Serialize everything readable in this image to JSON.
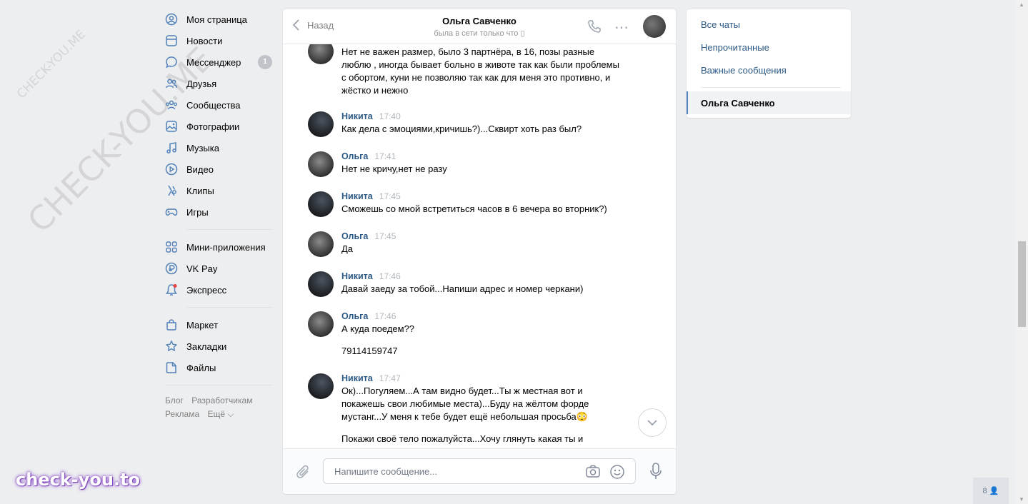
{
  "nav": {
    "items": [
      {
        "label": "Моя страница",
        "icon": "user-circle-icon"
      },
      {
        "label": "Новости",
        "icon": "news-icon"
      },
      {
        "label": "Мессенджер",
        "icon": "message-icon",
        "badge": "1"
      },
      {
        "label": "Друзья",
        "icon": "friends-icon"
      },
      {
        "label": "Сообщества",
        "icon": "communities-icon"
      },
      {
        "label": "Фотографии",
        "icon": "photo-icon"
      },
      {
        "label": "Музыка",
        "icon": "music-icon"
      },
      {
        "label": "Видео",
        "icon": "video-icon"
      },
      {
        "label": "Клипы",
        "icon": "clips-icon"
      },
      {
        "label": "Игры",
        "icon": "gamepad-icon"
      }
    ],
    "items2": [
      {
        "label": "Мини-приложения",
        "icon": "apps-icon"
      },
      {
        "label": "VK Pay",
        "icon": "vkpay-icon"
      },
      {
        "label": "Экспресс",
        "icon": "express-icon"
      }
    ],
    "items3": [
      {
        "label": "Маркет",
        "icon": "market-icon"
      },
      {
        "label": "Закладки",
        "icon": "bookmark-star-icon"
      },
      {
        "label": "Файлы",
        "icon": "file-icon"
      }
    ],
    "footer": [
      "Блог",
      "Разработчикам",
      "Реклама",
      "Ещё ⌵"
    ]
  },
  "chat": {
    "back_label": "Назад",
    "peer_name": "Ольга Савченко",
    "peer_status": "была в сети только что",
    "composer_placeholder": "Напишите сообщение...",
    "messages": [
      {
        "author": "",
        "time": "",
        "text": "Нет не важен размер, было 3 партнёра, в 16, позы разные люблю , иногда бывает больно в животе так как были проблемы с обортом, куни не позволяю так как для меня это противно, и жёстко и нежно"
      },
      {
        "author": "Никита",
        "time": "17:40",
        "text": "Как дела с эмоциями,кричишь?)...Сквирт хоть раз был?"
      },
      {
        "author": "Ольга",
        "time": "17:41",
        "text": "Нет не кричу,нет не разу"
      },
      {
        "author": "Никита",
        "time": "17:45",
        "text": "Сможешь со мной встретиться часов в 6 вечера во вторник?)"
      },
      {
        "author": "Ольга",
        "time": "17:45",
        "text": "Да"
      },
      {
        "author": "Никита",
        "time": "17:46",
        "text": "Давай заеду за тобой...Напиши адрес и номер черкани)"
      },
      {
        "author": "Ольга",
        "time": "17:46",
        "text": "А куда поедем??",
        "extra": "79114159747"
      },
      {
        "author": "Никита",
        "time": "17:47",
        "text": "Ок)...Погуляем...А там видно будет...Ты ж местная вот и покажешь свои любимые места)...Буду на жёлтом форде мустанг...У меня к тебе будет ещё небольшая просьба😳",
        "extra": "Покажи своё тело пожалуйста...Хочу глянуть какая ты и"
      }
    ]
  },
  "right_panel": {
    "items": [
      "Все чаты",
      "Непрочитанные",
      "Важные сообщения"
    ],
    "active_chat": "Ольга Савченко"
  },
  "widgets": {
    "online_count": "8",
    "brand_watermark": "check-you.to",
    "diag_watermark": "CHECK-YOU.ME"
  }
}
